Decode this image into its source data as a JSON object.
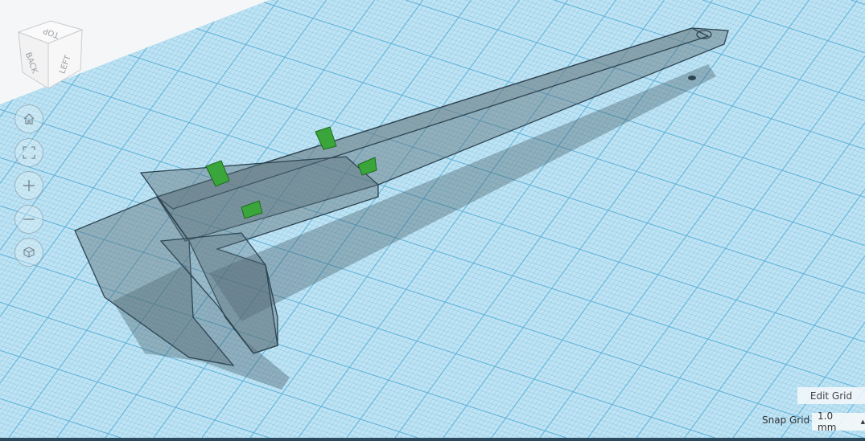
{
  "viewcube": {
    "top": "TOP",
    "back": "BACK",
    "left": "LEFT"
  },
  "nav_buttons": [
    {
      "icon": "home-icon"
    },
    {
      "icon": "fit-view-icon"
    },
    {
      "icon": "zoom-in-icon"
    },
    {
      "icon": "zoom-out-icon"
    },
    {
      "icon": "perspective-icon"
    }
  ],
  "grid": {
    "edit_label": "Edit Grid",
    "snap_label": "Snap Grid",
    "snap_value": "1.0 mm"
  },
  "colors": {
    "grid_bg": "#b9e0f2",
    "grid_line": "#5fb3da",
    "object": "#4e6470",
    "accent": "#3aa53a"
  }
}
